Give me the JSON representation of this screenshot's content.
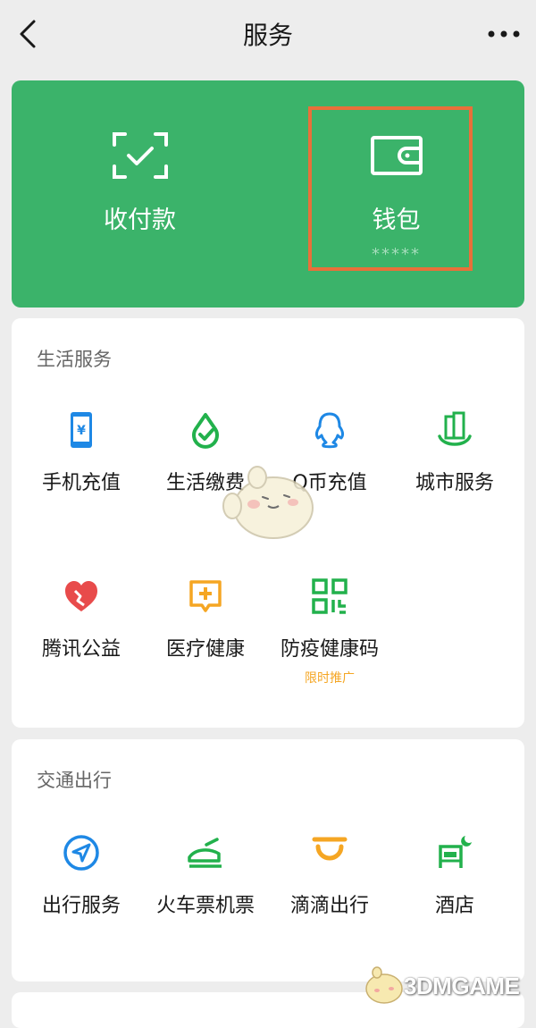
{
  "header": {
    "title": "服务"
  },
  "pay_card": {
    "receive_pay_label": "收付款",
    "wallet_label": "钱包",
    "wallet_balance_masked": "*****"
  },
  "life_services": {
    "title": "生活服务",
    "items": [
      {
        "label": "手机充值",
        "icon": "phone-topup-icon"
      },
      {
        "label": "生活缴费",
        "icon": "utility-payment-icon"
      },
      {
        "label": "Q币充值",
        "icon": "qcoin-icon"
      },
      {
        "label": "城市服务",
        "icon": "city-service-icon"
      },
      {
        "label": "腾讯公益",
        "icon": "charity-heart-icon"
      },
      {
        "label": "医疗健康",
        "icon": "medical-icon"
      },
      {
        "label": "防疫健康码",
        "icon": "health-code-icon",
        "tag": "限时推广"
      }
    ]
  },
  "transport": {
    "title": "交通出行",
    "items": [
      {
        "label": "出行服务",
        "icon": "navigation-icon"
      },
      {
        "label": "火车票机票",
        "icon": "train-ticket-icon"
      },
      {
        "label": "滴滴出行",
        "icon": "didi-icon"
      },
      {
        "label": "酒店",
        "icon": "hotel-bed-icon"
      }
    ]
  },
  "watermark": {
    "text": "3DMGAME"
  },
  "colors": {
    "brand_green": "#3bb36a",
    "highlight": "#e8703a",
    "tag_orange": "#f5a623",
    "icon_blue": "#1e88e5",
    "icon_green": "#22b14c",
    "icon_red": "#e84b4b",
    "icon_orange": "#f5a623"
  }
}
